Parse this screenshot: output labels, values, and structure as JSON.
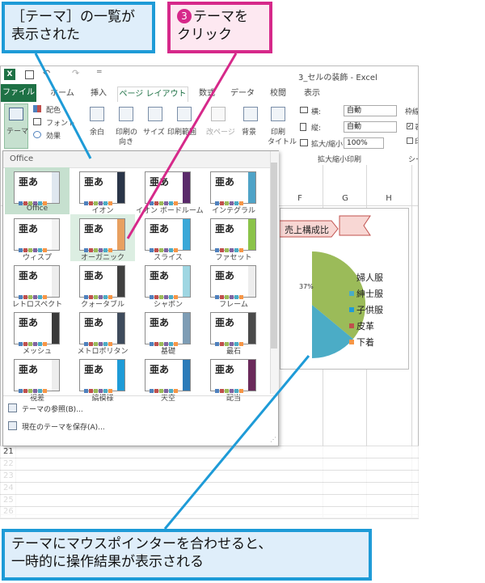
{
  "callouts": {
    "top_left": [
      "［テーマ］の一覧が",
      "表示された"
    ],
    "step_number": "3",
    "step": [
      "テーマを",
      "クリック"
    ],
    "bottom": [
      "テーマにマウスポインターを合わせると、",
      "一時的に操作結果が表示される"
    ]
  },
  "window": {
    "title": "3_セルの装飾 - Excel",
    "tabs": [
      {
        "label": "ファイル"
      },
      {
        "label": "ホーム"
      },
      {
        "label": "挿入"
      },
      {
        "label": "ページ レイアウト"
      },
      {
        "label": "数式"
      },
      {
        "label": "データ"
      },
      {
        "label": "校閲"
      },
      {
        "label": "表示"
      }
    ]
  },
  "ribbon": {
    "theme_label": "テーマ",
    "colors_label": "配色",
    "fonts_label": "フォント",
    "effects_label": "効果",
    "margins_label": "余白",
    "orientation_label": [
      "印刷の",
      "向き"
    ],
    "size_label": "サイズ",
    "print_area_label": "印刷範囲",
    "breaks_label": "改ページ",
    "background_label": "背景",
    "print_titles_label": [
      "印刷",
      "タイトル"
    ],
    "width_label": "横:",
    "width_value": "自動",
    "height_label": "縦:",
    "height_value": "自動",
    "scale_label": "拡大/縮小:",
    "scale_value": "100%",
    "group_scale": "拡大縮小印刷",
    "gridlines_label": "枠線",
    "view_label": "表示",
    "print_label": "印刷",
    "group_sheet": "シート"
  },
  "sheet": {
    "columns": [
      "F",
      "G",
      "H"
    ],
    "rows": [
      "21",
      "22",
      "23",
      "24",
      "25",
      "26"
    ]
  },
  "chart_data": {
    "type": "pie",
    "title": "売上構成比",
    "data_label": "37%",
    "legend": [
      "婦人服",
      "紳士服",
      "子供服",
      "皮革",
      "下着"
    ],
    "colors": [
      "#9bbb59",
      "#4bacc6",
      "#1f9bd7",
      "#c0504d",
      "#f79646"
    ]
  },
  "gallery": {
    "section": "Office",
    "themes": [
      {
        "name": "Office",
        "accent": "#dfe7ef",
        "state": "selected"
      },
      {
        "name": "イオン",
        "accent": "#2a3548",
        "state": ""
      },
      {
        "name": "イオン ボードルーム",
        "accent": "#5a2a6a",
        "state": ""
      },
      {
        "name": "インテグラル",
        "accent": "#4fa3c7",
        "state": ""
      },
      {
        "name": "ウィスプ",
        "accent": "#f2f2f2",
        "state": ""
      },
      {
        "name": "オーガニック",
        "accent": "#e8a060",
        "state": "hover"
      },
      {
        "name": "スライス",
        "accent": "#3aa8d8",
        "state": ""
      },
      {
        "name": "ファセット",
        "accent": "#8bc34a",
        "state": ""
      },
      {
        "name": "レトロスペクト",
        "accent": "#ededed",
        "state": ""
      },
      {
        "name": "クォータブル",
        "accent": "#404040",
        "state": ""
      },
      {
        "name": "シャボン",
        "accent": "#9fd6e2",
        "state": ""
      },
      {
        "name": "フレーム",
        "accent": "#ededed",
        "state": ""
      },
      {
        "name": "メッシュ",
        "accent": "#3a3a3a",
        "state": ""
      },
      {
        "name": "メトロポリタン",
        "accent": "#3e4b5c",
        "state": ""
      },
      {
        "name": "基礎",
        "accent": "#7e9db5",
        "state": ""
      },
      {
        "name": "最石",
        "accent": "#4a4a4a",
        "state": ""
      },
      {
        "name": "視差",
        "accent": "#ededed",
        "state": ""
      },
      {
        "name": "縞模様",
        "accent": "#1e9bd7",
        "state": ""
      },
      {
        "name": "天空",
        "accent": "#2b7bb9",
        "state": ""
      },
      {
        "name": "配当",
        "accent": "#6a2a5a",
        "state": ""
      }
    ],
    "swatch_colors": [
      "#4f81bd",
      "#c0504d",
      "#9bbb59",
      "#8064a2",
      "#4bacc6",
      "#f79646"
    ],
    "menu": [
      {
        "label": "テーマの参照(B)..."
      },
      {
        "label": "現在のテーマを保存(A)..."
      }
    ]
  }
}
